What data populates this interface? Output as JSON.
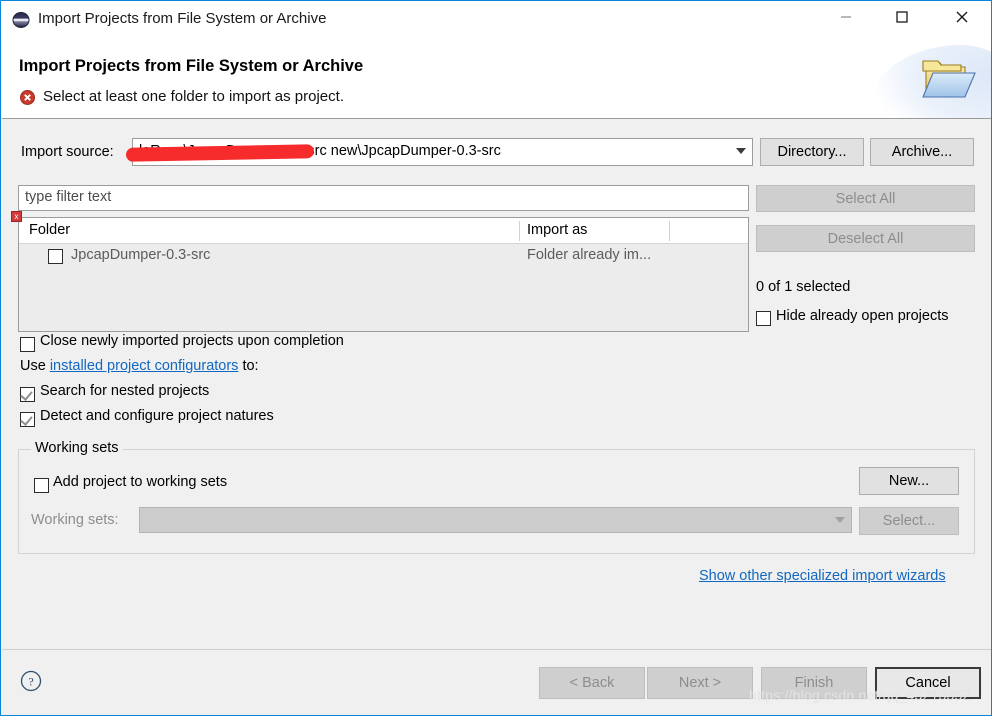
{
  "window": {
    "title": "Import Projects from File System or Archive",
    "app_icon": "eclipse-icon",
    "controls": {
      "minimize": "minimize-icon",
      "maximize": "maximize-icon",
      "close": "close-icon"
    }
  },
  "header": {
    "title": "Import Projects from File System or Archive",
    "message": "Select at least one folder to import as project.",
    "message_status": "error",
    "status_color": "#c0392b",
    "banner_icon": "open-folder-icon"
  },
  "import_source": {
    "label": "Import source:",
    "value": "leRecv\\JpcapDumper-0.3-src new\\JpcapDumper-0.3-src",
    "redacted": true,
    "directory_button": "Directory...",
    "archive_button": "Archive..."
  },
  "filter": {
    "placeholder": "type filter text",
    "value": ""
  },
  "table": {
    "columns": [
      "Folder",
      "Import as"
    ],
    "rows": [
      {
        "checked": false,
        "folder": "JpcapDumper-0.3-src",
        "import_as": "Folder already im..."
      }
    ],
    "error_decorator": "x"
  },
  "selection_panel": {
    "select_all": "Select All",
    "select_all_enabled": false,
    "deselect_all": "Deselect All",
    "deselect_all_enabled": false,
    "count_text": "0 of 1 selected",
    "hide_open_projects": {
      "label": "Hide already open projects",
      "checked": false
    }
  },
  "options": {
    "close_newly_imported": {
      "label": "Close newly imported projects upon completion",
      "checked": false
    },
    "use_prefix": "Use ",
    "configurators_link": "installed project configurators",
    "use_suffix": " to:",
    "search_nested": {
      "label": "Search for nested projects",
      "checked": true
    },
    "detect_natures": {
      "label": "Detect and configure project natures",
      "checked": true
    }
  },
  "working_sets": {
    "legend": "Working sets",
    "add_project": {
      "label": "Add project to working sets",
      "checked": false
    },
    "new_button": "New...",
    "combo_label": "Working sets:",
    "combo_value": "",
    "combo_enabled": false,
    "select_button": "Select...",
    "select_enabled": false
  },
  "links": {
    "show_other_wizards": "Show other specialized import wizards"
  },
  "footer": {
    "help_icon": "help-icon",
    "back": "< Back",
    "back_enabled": false,
    "next": "Next >",
    "next_enabled": false,
    "finish": "Finish",
    "finish_enabled": false,
    "cancel": "Cancel",
    "cancel_enabled": true
  },
  "watermark": "https://blog.csdn.net/qq_43213352"
}
